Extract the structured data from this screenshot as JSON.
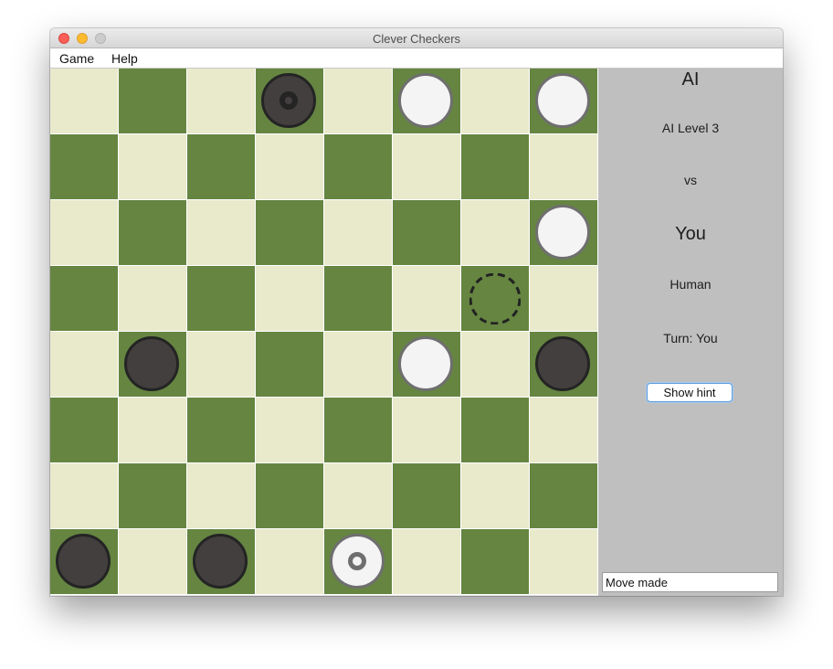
{
  "window": {
    "title": "Clever Checkers"
  },
  "menu": {
    "game_label": "Game",
    "help_label": "Help"
  },
  "board": {
    "light_color": "#e9e9cc",
    "dark_color": "#658541",
    "pieces": [
      {
        "row": 0,
        "col": 3,
        "color": "black",
        "king": true
      },
      {
        "row": 0,
        "col": 5,
        "color": "white",
        "king": false
      },
      {
        "row": 0,
        "col": 7,
        "color": "white",
        "king": false
      },
      {
        "row": 2,
        "col": 7,
        "color": "white",
        "king": false
      },
      {
        "row": 4,
        "col": 1,
        "color": "black",
        "king": false
      },
      {
        "row": 4,
        "col": 5,
        "color": "white",
        "king": false
      },
      {
        "row": 4,
        "col": 7,
        "color": "black",
        "king": false
      },
      {
        "row": 7,
        "col": 0,
        "color": "black",
        "king": false
      },
      {
        "row": 7,
        "col": 2,
        "color": "black",
        "king": false
      },
      {
        "row": 7,
        "col": 4,
        "color": "white",
        "king": true
      }
    ],
    "move_target": {
      "row": 3,
      "col": 6
    }
  },
  "sidebar": {
    "player1_name": "AI",
    "player1_type": "AI Level 3",
    "versus": "vs",
    "player2_name": "You",
    "player2_type": "Human",
    "turn_text": "Turn: You",
    "hint_button_label": "Show hint",
    "status_text": "Move made"
  }
}
